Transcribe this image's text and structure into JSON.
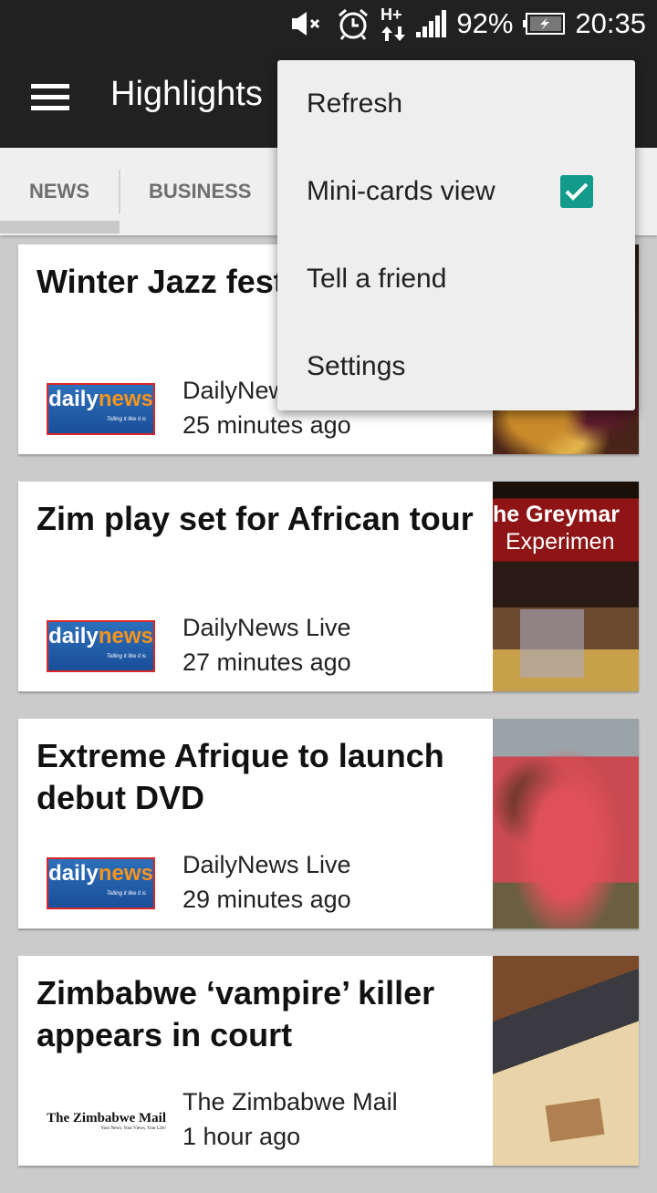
{
  "status_bar": {
    "icons": [
      "mute-icon",
      "alarm-icon",
      "hplus-data-icon",
      "signal-icon",
      "battery-charging-icon"
    ],
    "network_type": "H+",
    "battery": "92%",
    "time": "20:35"
  },
  "app_bar": {
    "title": "Highlights",
    "menu_icon": "hamburger-icon"
  },
  "tabs": [
    {
      "label": "NEWS",
      "selected": true
    },
    {
      "label": "BUSINESS",
      "selected": false
    }
  ],
  "overflow_menu": {
    "items": [
      {
        "label": "Refresh"
      },
      {
        "label": "Mini-cards view",
        "checked": true
      },
      {
        "label": "Tell a friend"
      },
      {
        "label": "Settings"
      }
    ],
    "accent_color": "#129b8a"
  },
  "articles": [
    {
      "title": "Winter Jazz fest for split",
      "source": "DailyNews Live",
      "time": "25 minutes ago",
      "logo": "dailynews",
      "image": "concert crowd"
    },
    {
      "title": "Zim play set for African tour",
      "source": "DailyNews Live",
      "time": "27 minutes ago",
      "logo": "dailynews",
      "image": "The Greyman Experiment",
      "image_text_1": "he Greymar",
      "image_text_2": "Experimen"
    },
    {
      "title": "Extreme Afrique to launch debut DVD",
      "source": "DailyNews Live",
      "time": "29 minutes ago",
      "logo": "dailynews",
      "image": "group photo in red"
    },
    {
      "title": "Zimbabwe ‘vampire’ killer appears in court",
      "source": "The Zimbabwe Mail",
      "time": "1 hour ago",
      "logo": "zimbabwemail",
      "image": "court gavel"
    }
  ],
  "logos": {
    "dailynews": {
      "word1": "daily",
      "word2": "news",
      "tagline": "Telling it like it is"
    },
    "zimbabwemail": {
      "name": "The Zimbabwe Mail",
      "tagline": "Your News, Your Views, Your Life!"
    }
  }
}
